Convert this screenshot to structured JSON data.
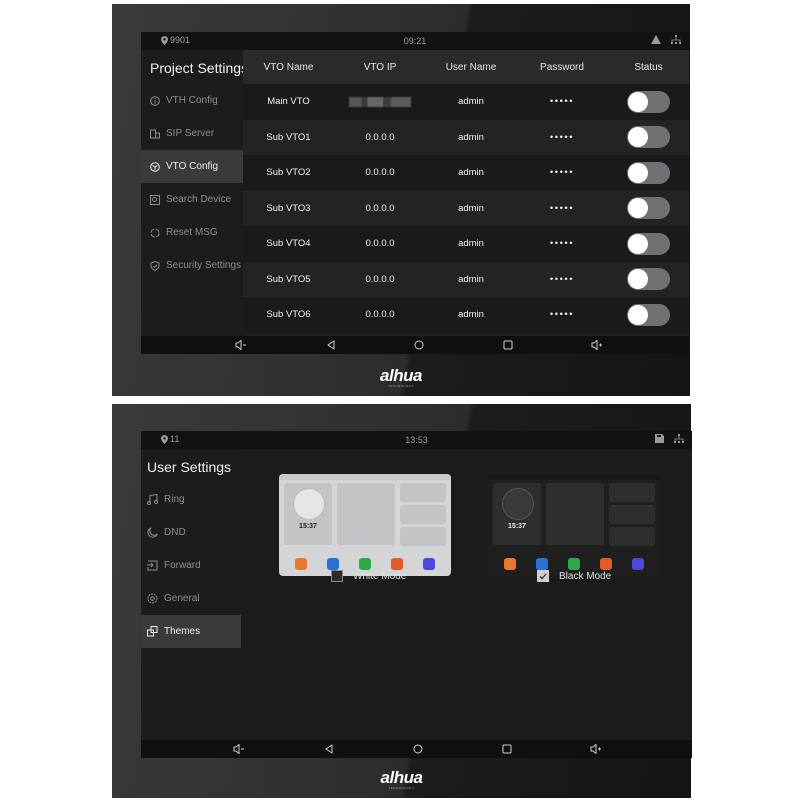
{
  "screen1": {
    "status": {
      "location_icon": "location-pin-icon",
      "location": "9901",
      "time": "09:21",
      "right_icons": [
        "warning-icon",
        "network-icon"
      ]
    },
    "sidebar": {
      "title": "Project Settings",
      "items": [
        {
          "label": "VTH Config",
          "icon": "info-icon",
          "active": false
        },
        {
          "label": "SIP Server",
          "icon": "server-icon",
          "active": false
        },
        {
          "label": "VTO Config",
          "icon": "cube-icon",
          "active": true
        },
        {
          "label": "Search Device",
          "icon": "search-device-icon",
          "active": false
        },
        {
          "label": "Reset MSG",
          "icon": "reset-icon",
          "active": false
        },
        {
          "label": "Security Settings",
          "icon": "shield-icon",
          "active": false
        }
      ]
    },
    "table": {
      "headers": [
        "VTO Name",
        "VTO IP",
        "User Name",
        "Password",
        "Status"
      ],
      "rows": [
        {
          "name": "Main VTO",
          "ip": "",
          "ip_blurred": true,
          "user": "admin",
          "password": "•••••",
          "status_on": false
        },
        {
          "name": "Sub VTO1",
          "ip": "0.0.0.0",
          "user": "admin",
          "password": "•••••",
          "status_on": false
        },
        {
          "name": "Sub VTO2",
          "ip": "0.0.0.0",
          "user": "admin",
          "password": "•••••",
          "status_on": false
        },
        {
          "name": "Sub VTO3",
          "ip": "0.0.0.0",
          "user": "admin",
          "password": "•••••",
          "status_on": false
        },
        {
          "name": "Sub VTO4",
          "ip": "0.0.0.0",
          "user": "admin",
          "password": "•••••",
          "status_on": false
        },
        {
          "name": "Sub VTO5",
          "ip": "0.0.0.0",
          "user": "admin",
          "password": "•••••",
          "status_on": false
        },
        {
          "name": "Sub VTO6",
          "ip": "0.0.0.0",
          "user": "admin",
          "password": "•••••",
          "status_on": false
        }
      ]
    },
    "navbar": [
      "volume-down-icon",
      "back-icon",
      "home-icon",
      "recents-icon",
      "volume-up-icon"
    ],
    "brand": {
      "logo": "alhua",
      "tagline": "TECHNOLOGY"
    }
  },
  "screen2": {
    "status": {
      "location_icon": "location-pin-icon",
      "location": "11",
      "time": "13:53",
      "right_icons": [
        "sd-card-icon",
        "network-icon"
      ]
    },
    "sidebar": {
      "title": "User Settings",
      "items": [
        {
          "label": "Ring",
          "icon": "music-icon",
          "active": false
        },
        {
          "label": "DND",
          "icon": "moon-icon",
          "active": false
        },
        {
          "label": "Forward",
          "icon": "forward-icon",
          "active": false
        },
        {
          "label": "General",
          "icon": "gear-icon",
          "active": false
        },
        {
          "label": "Themes",
          "icon": "themes-icon",
          "active": true
        }
      ]
    },
    "themes": [
      {
        "label": "White Mode",
        "checked": false,
        "preview_time": "15:37"
      },
      {
        "label": "Black Mode",
        "checked": true,
        "preview_time": "15:37"
      }
    ],
    "preview_app_colors": [
      "#e8782a",
      "#2a6fd6",
      "#2fa84a",
      "#e05a2a",
      "#4a4ad6"
    ],
    "navbar": [
      "volume-down-icon",
      "back-icon",
      "home-icon",
      "recents-icon",
      "volume-up-icon"
    ],
    "brand": {
      "logo": "alhua",
      "tagline": "TECHNOLOGY"
    }
  }
}
